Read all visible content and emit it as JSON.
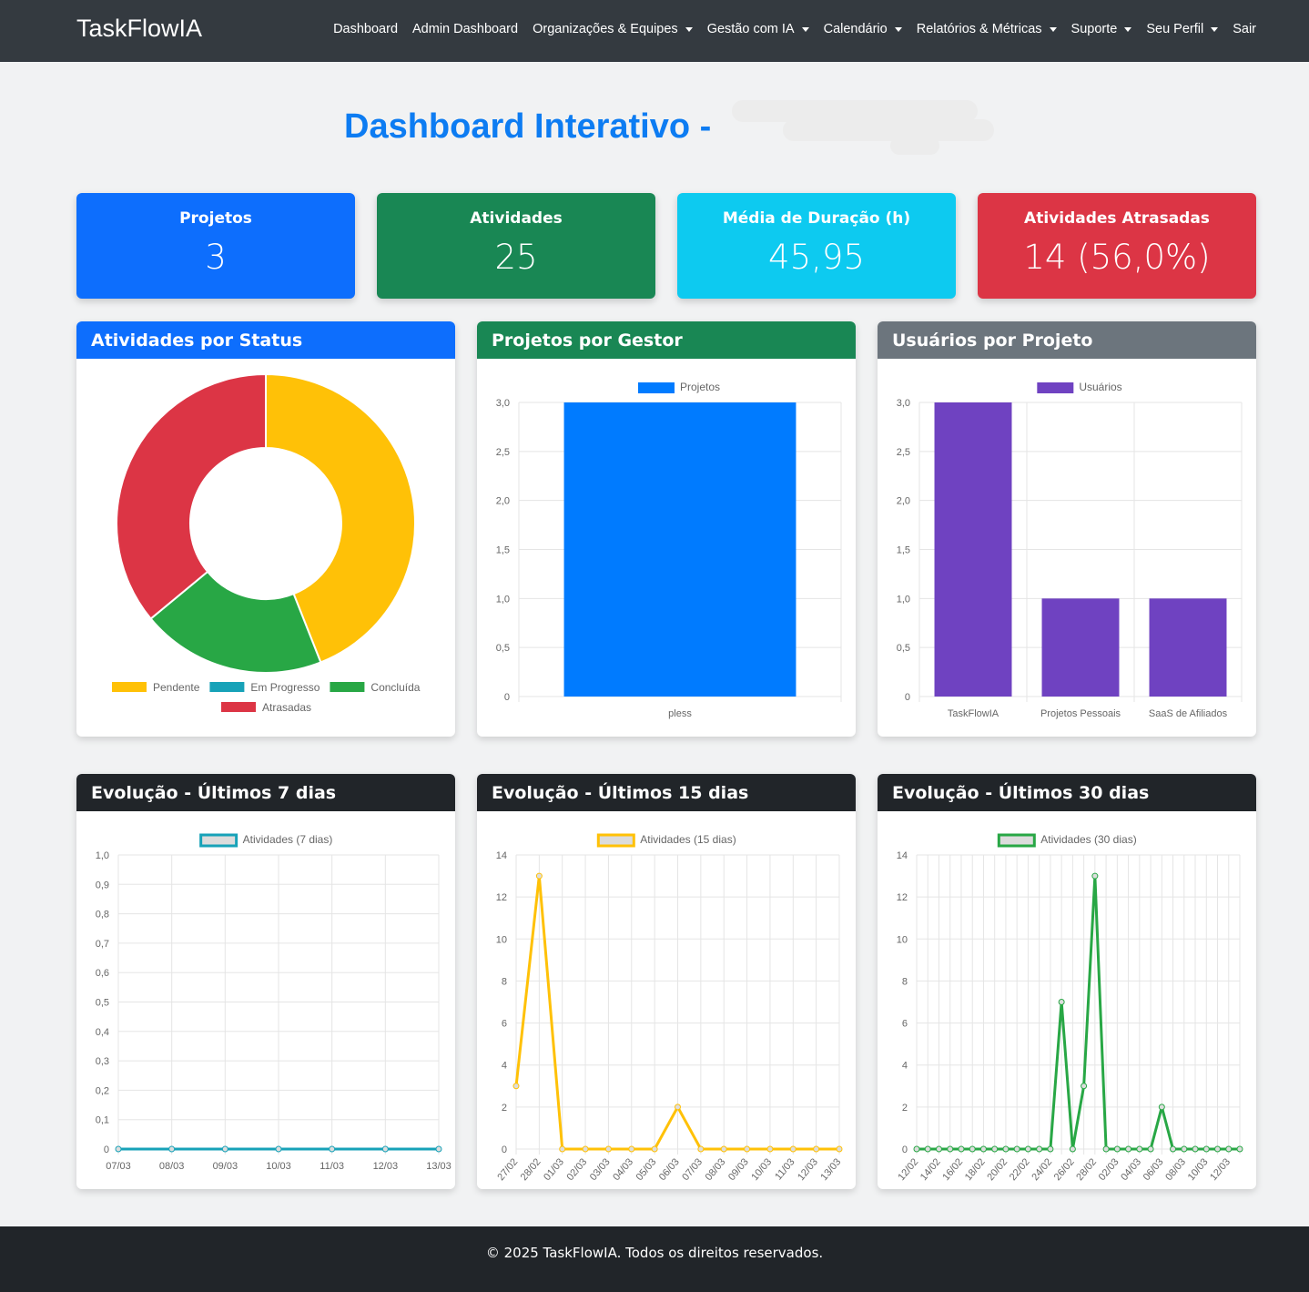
{
  "navbar": {
    "brand": "TaskFlowIA",
    "items": [
      {
        "label": "Dashboard",
        "dropdown": false
      },
      {
        "label": "Admin Dashboard",
        "dropdown": false
      },
      {
        "label": "Organizações & Equipes",
        "dropdown": true
      },
      {
        "label": "Gestão com IA",
        "dropdown": true
      },
      {
        "label": "Calendário",
        "dropdown": true
      },
      {
        "label": "Relatórios & Métricas",
        "dropdown": true
      },
      {
        "label": "Suporte",
        "dropdown": true
      },
      {
        "label": "Seu Perfil",
        "dropdown": true
      },
      {
        "label": "Sair",
        "dropdown": false
      }
    ]
  },
  "page": {
    "title": "Dashboard Interativo -"
  },
  "stats": [
    {
      "title": "Projetos",
      "value": "3",
      "color": "#0d6efd"
    },
    {
      "title": "Atividades",
      "value": "25",
      "color": "#198754"
    },
    {
      "title": "Média de Duração (h)",
      "value": "45,95",
      "color": "#0dcaf0"
    },
    {
      "title": "Atividades Atrasadas",
      "value": "14 (56,0%)",
      "color": "#dc3545"
    }
  ],
  "cards": {
    "status": {
      "title": "Atividades por Status",
      "color": "#0d6efd"
    },
    "gestor": {
      "title": "Projetos por Gestor",
      "color": "#198754"
    },
    "usuarios": {
      "title": "Usuários por Projeto",
      "color": "#6c757d"
    },
    "evo7": {
      "title": "Evolução - Últimos 7 dias",
      "color": "#212529"
    },
    "evo15": {
      "title": "Evolução - Últimos 15 dias",
      "color": "#212529"
    },
    "evo30": {
      "title": "Evolução - Últimos 30 dias",
      "color": "#212529"
    }
  },
  "chart_data": [
    {
      "id": "status",
      "type": "pie",
      "categories": [
        "Pendente",
        "Em Progresso",
        "Concluída",
        "Atrasadas"
      ],
      "values": [
        11,
        0,
        5,
        9
      ],
      "colors": [
        "#ffc107",
        "#17a2b8",
        "#28a745",
        "#dc3545"
      ],
      "legend": "bottom"
    },
    {
      "id": "gestor",
      "type": "bar",
      "categories": [
        "pless"
      ],
      "series": [
        {
          "name": "Projetos",
          "values": [
            3
          ]
        }
      ],
      "ylim": [
        0,
        3
      ],
      "yticks": [
        "0",
        "0,5",
        "1,0",
        "1,5",
        "2,0",
        "2,5",
        "3,0"
      ],
      "color": "#007bff",
      "legend": "top"
    },
    {
      "id": "usuarios",
      "type": "bar",
      "categories": [
        "TaskFlowIA",
        "Projetos Pessoais",
        "SaaS de Afiliados"
      ],
      "series": [
        {
          "name": "Usuários",
          "values": [
            3,
            1,
            1
          ]
        }
      ],
      "ylim": [
        0,
        3
      ],
      "yticks": [
        "0",
        "0,5",
        "1,0",
        "1,5",
        "2,0",
        "2,5",
        "3,0"
      ],
      "color": "#6f42c1",
      "legend": "top"
    },
    {
      "id": "evo7",
      "type": "line",
      "x": [
        "07/03",
        "08/03",
        "09/03",
        "10/03",
        "11/03",
        "12/03",
        "13/03"
      ],
      "series": [
        {
          "name": "Atividades (7 dias)",
          "values": [
            0,
            0,
            0,
            0,
            0,
            0,
            0
          ]
        }
      ],
      "ylim": [
        0,
        1
      ],
      "yticks": [
        "0",
        "0,1",
        "0,2",
        "0,3",
        "0,4",
        "0,5",
        "0,6",
        "0,7",
        "0,8",
        "0,9",
        "1,0"
      ],
      "color": "#17a2b8",
      "legend": "top"
    },
    {
      "id": "evo15",
      "type": "line",
      "x": [
        "27/02",
        "28/02",
        "01/03",
        "02/03",
        "03/03",
        "04/03",
        "05/03",
        "06/03",
        "07/03",
        "08/03",
        "09/03",
        "10/03",
        "11/03",
        "12/03",
        "13/03"
      ],
      "series": [
        {
          "name": "Atividades (15 dias)",
          "values": [
            3,
            13,
            0,
            0,
            0,
            0,
            0,
            2,
            0,
            0,
            0,
            0,
            0,
            0,
            0
          ]
        }
      ],
      "ylim": [
        0,
        14
      ],
      "yticks": [
        "0",
        "2",
        "4",
        "6",
        "8",
        "10",
        "12",
        "14"
      ],
      "color": "#ffc107",
      "legend": "top"
    },
    {
      "id": "evo30",
      "type": "line",
      "x": [
        "12/02",
        "13/02",
        "14/02",
        "15/02",
        "16/02",
        "17/02",
        "18/02",
        "19/02",
        "20/02",
        "21/02",
        "22/02",
        "23/02",
        "24/02",
        "25/02",
        "26/02",
        "27/02",
        "28/02",
        "01/03",
        "02/03",
        "03/03",
        "04/03",
        "05/03",
        "06/03",
        "07/03",
        "08/03",
        "09/03",
        "10/03",
        "11/03",
        "12/03",
        "13/03"
      ],
      "xticks": [
        "12/02",
        "14/02",
        "16/02",
        "18/02",
        "20/02",
        "22/02",
        "24/02",
        "26/02",
        "28/02",
        "02/03",
        "04/03",
        "06/03",
        "08/03",
        "10/03",
        "12/03"
      ],
      "series": [
        {
          "name": "Atividades (30 dias)",
          "values": [
            0,
            0,
            0,
            0,
            0,
            0,
            0,
            0,
            0,
            0,
            0,
            0,
            0,
            7,
            0,
            3,
            13,
            0,
            0,
            0,
            0,
            0,
            2,
            0,
            0,
            0,
            0,
            0,
            0,
            0
          ]
        }
      ],
      "ylim": [
        0,
        14
      ],
      "yticks": [
        "0",
        "2",
        "4",
        "6",
        "8",
        "10",
        "12",
        "14"
      ],
      "color": "#28a745",
      "legend": "top"
    }
  ],
  "footer": {
    "text": "© 2025 TaskFlowIA. Todos os direitos reservados."
  }
}
